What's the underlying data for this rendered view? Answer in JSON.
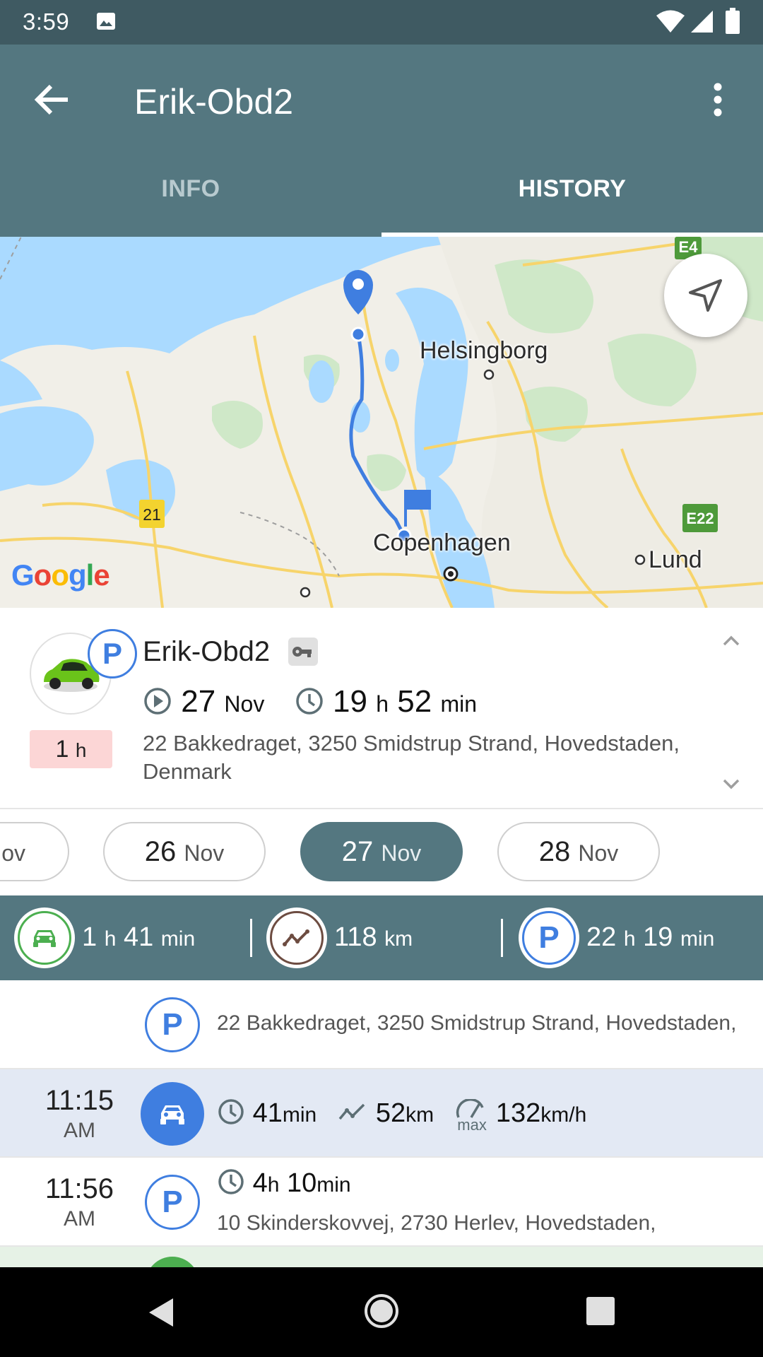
{
  "status_bar": {
    "time": "3:59"
  },
  "app_bar": {
    "title": "Erik-Obd2"
  },
  "tabs": [
    {
      "label": "INFO",
      "selected": false
    },
    {
      "label": "HISTORY",
      "selected": true
    }
  ],
  "map": {
    "labels": {
      "helsingborg": "Helsingborg",
      "copenhagen": "Copenhagen",
      "lund": "Lund",
      "road_21": "21",
      "road_e4": "E4",
      "road_e22": "E22"
    },
    "logo": "Google"
  },
  "summary": {
    "vehicle_name": "Erik-Obd2",
    "start_day": "27",
    "start_month": "Nov",
    "duration_h": "19",
    "duration_h_unit": "h",
    "duration_min": "52",
    "duration_min_unit": "min",
    "badge_value": "1",
    "badge_unit": "h",
    "address": "22 Bakkedraget, 3250 Smidstrup Strand, Hovedstaden, Denmark",
    "parking_letter": "P"
  },
  "dates": [
    {
      "day": "",
      "month": "Nov",
      "selected": false
    },
    {
      "day": "26",
      "month": "Nov",
      "selected": false
    },
    {
      "day": "27",
      "month": "Nov",
      "selected": true
    },
    {
      "day": "28",
      "month": "Nov",
      "selected": false
    }
  ],
  "stats": {
    "drive_h": "1",
    "drive_h_unit": "h",
    "drive_min": "41",
    "drive_min_unit": "min",
    "distance": "118",
    "distance_unit": "km",
    "park_h": "22",
    "park_h_unit": "h",
    "park_min": "19",
    "park_min_unit": "min",
    "parking_letter": "P"
  },
  "timeline": [
    {
      "type": "parking",
      "letter": "P",
      "address": "22 Bakkedraget, 3250 Smidstrup Strand, Hovedstaden,"
    },
    {
      "type": "drive",
      "time": "11:15",
      "ampm": "AM",
      "duration": "41",
      "duration_unit": "min",
      "distance": "52",
      "distance_unit": "km",
      "max_label": "max",
      "max_speed": "132",
      "max_speed_unit": "km/h"
    },
    {
      "type": "parking",
      "letter": "P",
      "time": "11:56",
      "ampm": "AM",
      "dur_h": "4",
      "dur_h_unit": "h",
      "dur_min": "10",
      "dur_min_unit": "min",
      "address": "10 Skinderskovvej, 2730 Herlev, Hovedstaden,"
    }
  ],
  "colors": {
    "primary": "#547780",
    "status_bar": "#3f5a62",
    "parking_blue": "#3f7ee0",
    "drive_green": "#4caf50",
    "distance_brown": "#6d4c41",
    "selected_row": "#e3e9f4"
  }
}
